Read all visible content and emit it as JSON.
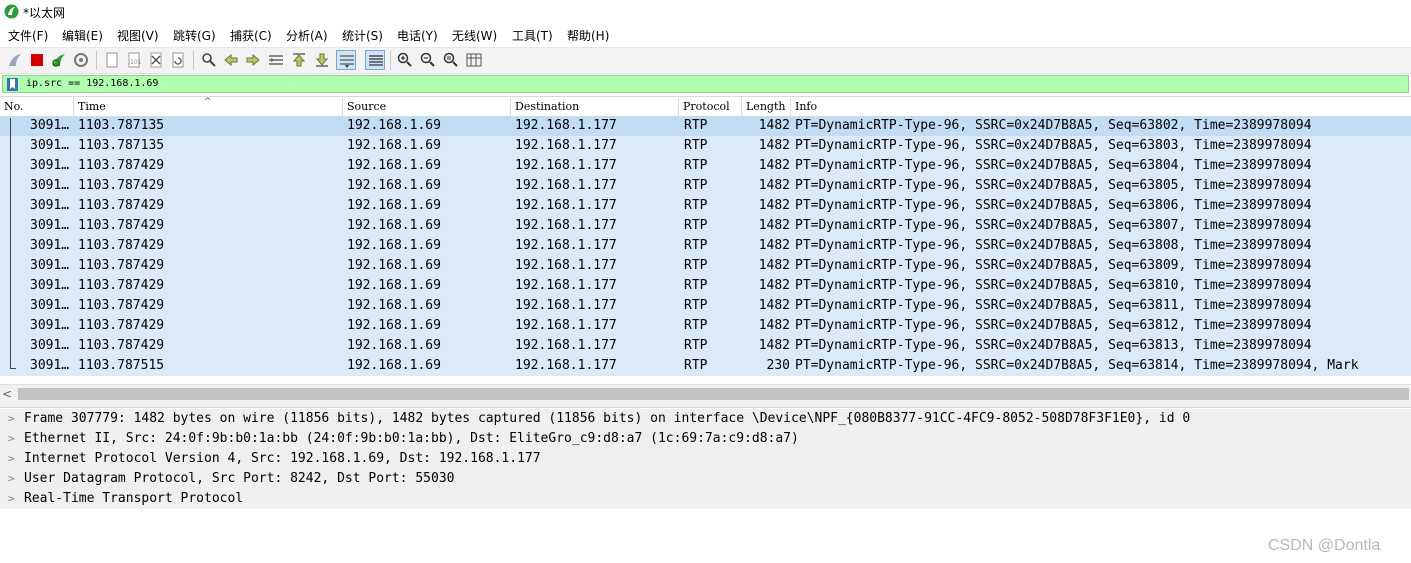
{
  "window": {
    "title": "*以太网"
  },
  "menu": [
    "文件(F)",
    "编辑(E)",
    "视图(V)",
    "跳转(G)",
    "捕获(C)",
    "分析(A)",
    "统计(S)",
    "电话(Y)",
    "无线(W)",
    "工具(T)",
    "帮助(H)"
  ],
  "toolbar": {
    "icons": [
      "shark-fin-start-icon",
      "stop-capture-icon",
      "restart-capture-icon",
      "capture-options-icon",
      "open-file-icon",
      "save-file-icon",
      "close-file-icon",
      "reload-file-icon",
      "find-packet-icon",
      "go-back-icon",
      "go-forward-icon",
      "go-to-packet-icon",
      "first-packet-icon",
      "last-packet-icon",
      "autoscroll-icon",
      "colorize-icon",
      "zoom-in-icon",
      "zoom-out-icon",
      "normal-size-icon",
      "resize-columns-icon"
    ]
  },
  "filter": {
    "value": "ip.src == 192.168.1.69"
  },
  "packet_list": {
    "columns": [
      "No.",
      "Time",
      "Source",
      "Destination",
      "Protocol",
      "Length",
      "Info"
    ],
    "rows": [
      {
        "no": "3091…",
        "time": "1103.787135",
        "src": "192.168.1.69",
        "dst": "192.168.1.177",
        "proto": "RTP",
        "len": "1482",
        "info": "PT=DynamicRTP-Type-96, SSRC=0x24D7B8A5, Seq=63802, Time=2389978094"
      },
      {
        "no": "3091…",
        "time": "1103.787135",
        "src": "192.168.1.69",
        "dst": "192.168.1.177",
        "proto": "RTP",
        "len": "1482",
        "info": "PT=DynamicRTP-Type-96, SSRC=0x24D7B8A5, Seq=63803, Time=2389978094"
      },
      {
        "no": "3091…",
        "time": "1103.787429",
        "src": "192.168.1.69",
        "dst": "192.168.1.177",
        "proto": "RTP",
        "len": "1482",
        "info": "PT=DynamicRTP-Type-96, SSRC=0x24D7B8A5, Seq=63804, Time=2389978094"
      },
      {
        "no": "3091…",
        "time": "1103.787429",
        "src": "192.168.1.69",
        "dst": "192.168.1.177",
        "proto": "RTP",
        "len": "1482",
        "info": "PT=DynamicRTP-Type-96, SSRC=0x24D7B8A5, Seq=63805, Time=2389978094"
      },
      {
        "no": "3091…",
        "time": "1103.787429",
        "src": "192.168.1.69",
        "dst": "192.168.1.177",
        "proto": "RTP",
        "len": "1482",
        "info": "PT=DynamicRTP-Type-96, SSRC=0x24D7B8A5, Seq=63806, Time=2389978094"
      },
      {
        "no": "3091…",
        "time": "1103.787429",
        "src": "192.168.1.69",
        "dst": "192.168.1.177",
        "proto": "RTP",
        "len": "1482",
        "info": "PT=DynamicRTP-Type-96, SSRC=0x24D7B8A5, Seq=63807, Time=2389978094"
      },
      {
        "no": "3091…",
        "time": "1103.787429",
        "src": "192.168.1.69",
        "dst": "192.168.1.177",
        "proto": "RTP",
        "len": "1482",
        "info": "PT=DynamicRTP-Type-96, SSRC=0x24D7B8A5, Seq=63808, Time=2389978094"
      },
      {
        "no": "3091…",
        "time": "1103.787429",
        "src": "192.168.1.69",
        "dst": "192.168.1.177",
        "proto": "RTP",
        "len": "1482",
        "info": "PT=DynamicRTP-Type-96, SSRC=0x24D7B8A5, Seq=63809, Time=2389978094"
      },
      {
        "no": "3091…",
        "time": "1103.787429",
        "src": "192.168.1.69",
        "dst": "192.168.1.177",
        "proto": "RTP",
        "len": "1482",
        "info": "PT=DynamicRTP-Type-96, SSRC=0x24D7B8A5, Seq=63810, Time=2389978094"
      },
      {
        "no": "3091…",
        "time": "1103.787429",
        "src": "192.168.1.69",
        "dst": "192.168.1.177",
        "proto": "RTP",
        "len": "1482",
        "info": "PT=DynamicRTP-Type-96, SSRC=0x24D7B8A5, Seq=63811, Time=2389978094"
      },
      {
        "no": "3091…",
        "time": "1103.787429",
        "src": "192.168.1.69",
        "dst": "192.168.1.177",
        "proto": "RTP",
        "len": "1482",
        "info": "PT=DynamicRTP-Type-96, SSRC=0x24D7B8A5, Seq=63812, Time=2389978094"
      },
      {
        "no": "3091…",
        "time": "1103.787429",
        "src": "192.168.1.69",
        "dst": "192.168.1.177",
        "proto": "RTP",
        "len": "1482",
        "info": "PT=DynamicRTP-Type-96, SSRC=0x24D7B8A5, Seq=63813, Time=2389978094"
      },
      {
        "no": "3091…",
        "time": "1103.787515",
        "src": "192.168.1.69",
        "dst": "192.168.1.177",
        "proto": "RTP",
        "len": "230",
        "info": "PT=DynamicRTP-Type-96, SSRC=0x24D7B8A5, Seq=63814, Time=2389978094, Mark"
      }
    ]
  },
  "details": [
    "Frame 307779: 1482 bytes on wire (11856 bits), 1482 bytes captured (11856 bits) on interface \\Device\\NPF_{080B8377-91CC-4FC9-8052-508D78F3F1E0}, id 0",
    "Ethernet II, Src: 24:0f:9b:b0:1a:bb (24:0f:9b:b0:1a:bb), Dst: EliteGro_c9:d8:a7 (1c:69:7a:c9:d8:a7)",
    "Internet Protocol Version 4, Src: 192.168.1.69, Dst: 192.168.1.177",
    "User Datagram Protocol, Src Port: 8242, Dst Port: 55030",
    "Real-Time Transport Protocol"
  ],
  "watermark": "CSDN @Dontla",
  "colors": {
    "filter_valid": "#afffaf",
    "row_bg": "#dbeaf9",
    "row_selected": "#c2dcf3"
  }
}
